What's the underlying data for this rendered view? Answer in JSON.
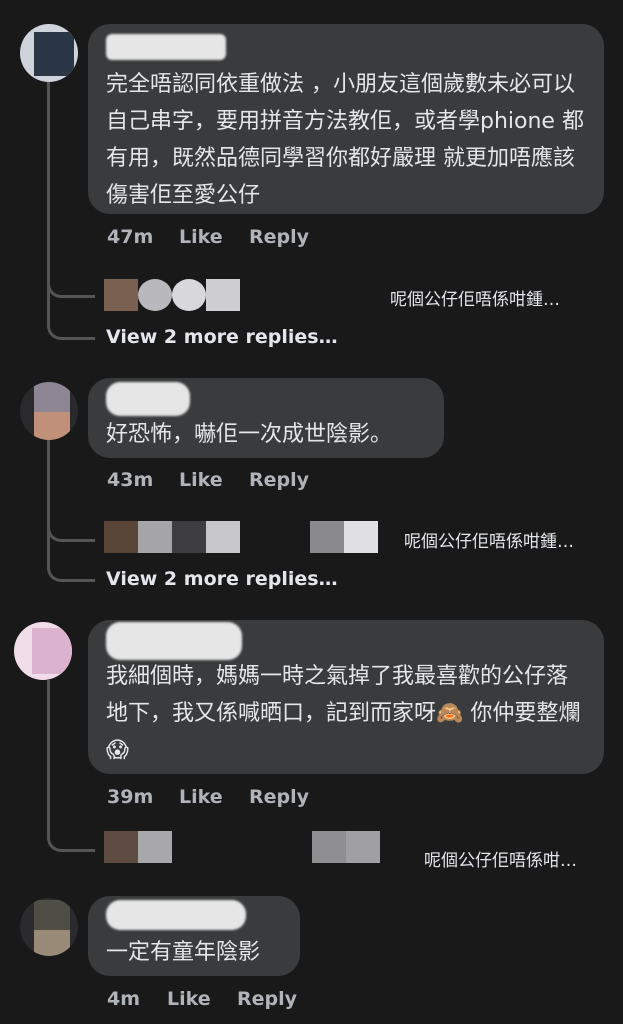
{
  "comments": [
    {
      "text": "完全唔認同依重做法 ，小朋友這個歲數未必可以自己串字，要用拼音方法教佢，或者學￼phione 都有用，既然品德同學習你都好嚴理 就更加唔應該傷害佢至愛公仔",
      "time": "47m",
      "like": "Like",
      "reply": "Reply",
      "reply_preview": "呢個公仔佢唔係咁鍾…",
      "view_more": "View 2 more replies…"
    },
    {
      "text": "好恐怖，嚇佢一次成世陰影。",
      "time": "43m",
      "like": "Like",
      "reply": "Reply",
      "reply_preview": "呢個公仔佢唔係咁鍾…",
      "view_more": "View 2 more replies…"
    },
    {
      "text_before": "我細個時，媽媽一時之氣掉了我最喜歡的公仔落地下，我又係喊晒口，記到而家呀",
      "emoji1": "🙈",
      "text_middle": " 你仲要整爛",
      "emoji2": "😱",
      "time": "39m",
      "like": "Like",
      "reply": "Reply",
      "reply_preview": "呢個公仔佢唔係咁…"
    },
    {
      "text": "一定有童年陰影",
      "time": "4m",
      "like": "Like",
      "reply": "Reply"
    }
  ],
  "colors": {
    "background": "#19191a",
    "bubble": "#3a3b3c",
    "text": "#e4e6eb",
    "meta": "#b0b3b8"
  }
}
